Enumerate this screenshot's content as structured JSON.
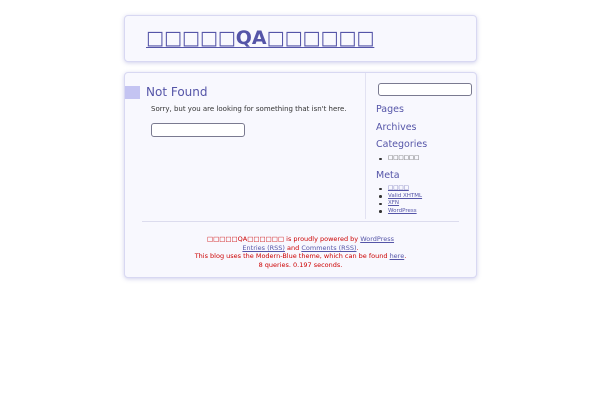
{
  "header": {
    "site_title": "□□□□□QA□□□□□□"
  },
  "main": {
    "title": "Not Found",
    "message": "Sorry, but you are looking for something that isn't here.",
    "search_value": ""
  },
  "sidebar": {
    "search_value": "",
    "pages_heading": "Pages",
    "archives_heading": "Archives",
    "categories_heading": "Categories",
    "categories": [
      "□□□□□□"
    ],
    "meta_heading": "Meta",
    "meta_links": [
      "□□□□",
      "Valid XHTML",
      "XFN",
      "WordPress"
    ]
  },
  "footer": {
    "line1_site": "□□□□□QA□□□□□□",
    "line1_text": " is proudly powered by ",
    "line1_link": "WordPress",
    "line2_entries": "Entries (RSS)",
    "line2_and": " and ",
    "line2_comments": "Comments (RSS)",
    "line2_end": ".",
    "line3_text": "This blog uses the Modern-Blue theme, which can be found ",
    "line3_link": "here",
    "line3_end": ".",
    "line4": "8 queries. 0.197 seconds."
  },
  "colors": {
    "accent": "#5555a8",
    "footer_text": "#cc0000",
    "marker": "#c4c4f2",
    "panel_bg": "#f8f8fe"
  }
}
